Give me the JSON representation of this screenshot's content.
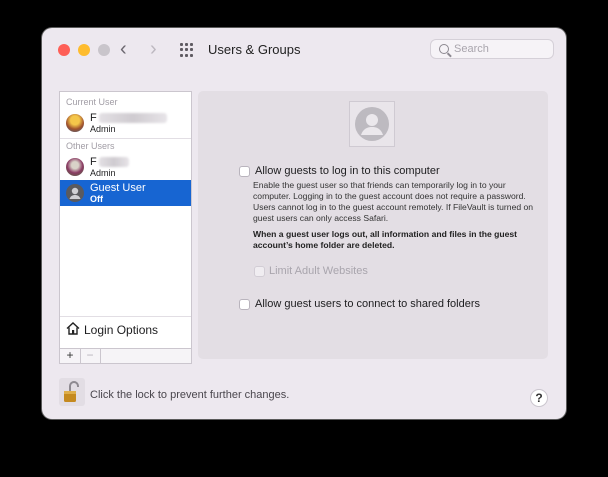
{
  "window": {
    "title": "Users & Groups",
    "search_placeholder": "Search",
    "nav_back": "‹",
    "nav_forward": "›"
  },
  "sidebar": {
    "current_user_header": "Current User",
    "current_user": {
      "name_visible": "F",
      "role": "Admin"
    },
    "other_users_header": "Other Users",
    "other_user": {
      "name_visible": "F",
      "role": "Admin"
    },
    "guest_user": {
      "name": "Guest User",
      "role": "Off"
    },
    "login_options": "Login Options",
    "plus": "+",
    "minus": "−"
  },
  "guest_pane": {
    "allow_login_label": "Allow guests to log in to this computer",
    "description": "Enable the guest user so that friends can temporarily log in to your computer. Logging in to the guest account does not require a password. Users cannot log in to the guest account remotely. If FileVault is turned on guest users can only access Safari.",
    "warning": "When a guest user logs out, all information and files in the guest account’s home folder are deleted.",
    "limit_adult_label": "Limit Adult Websites",
    "shared_folders_label": "Allow guest users to connect to shared folders"
  },
  "footer": {
    "lock_text": "Click the lock to prevent further changes.",
    "help": "?"
  },
  "colors": {
    "selection": "#1765d2",
    "window_bg": "#ede8ef",
    "close": "#fe5f57",
    "minimize": "#febc2e"
  }
}
